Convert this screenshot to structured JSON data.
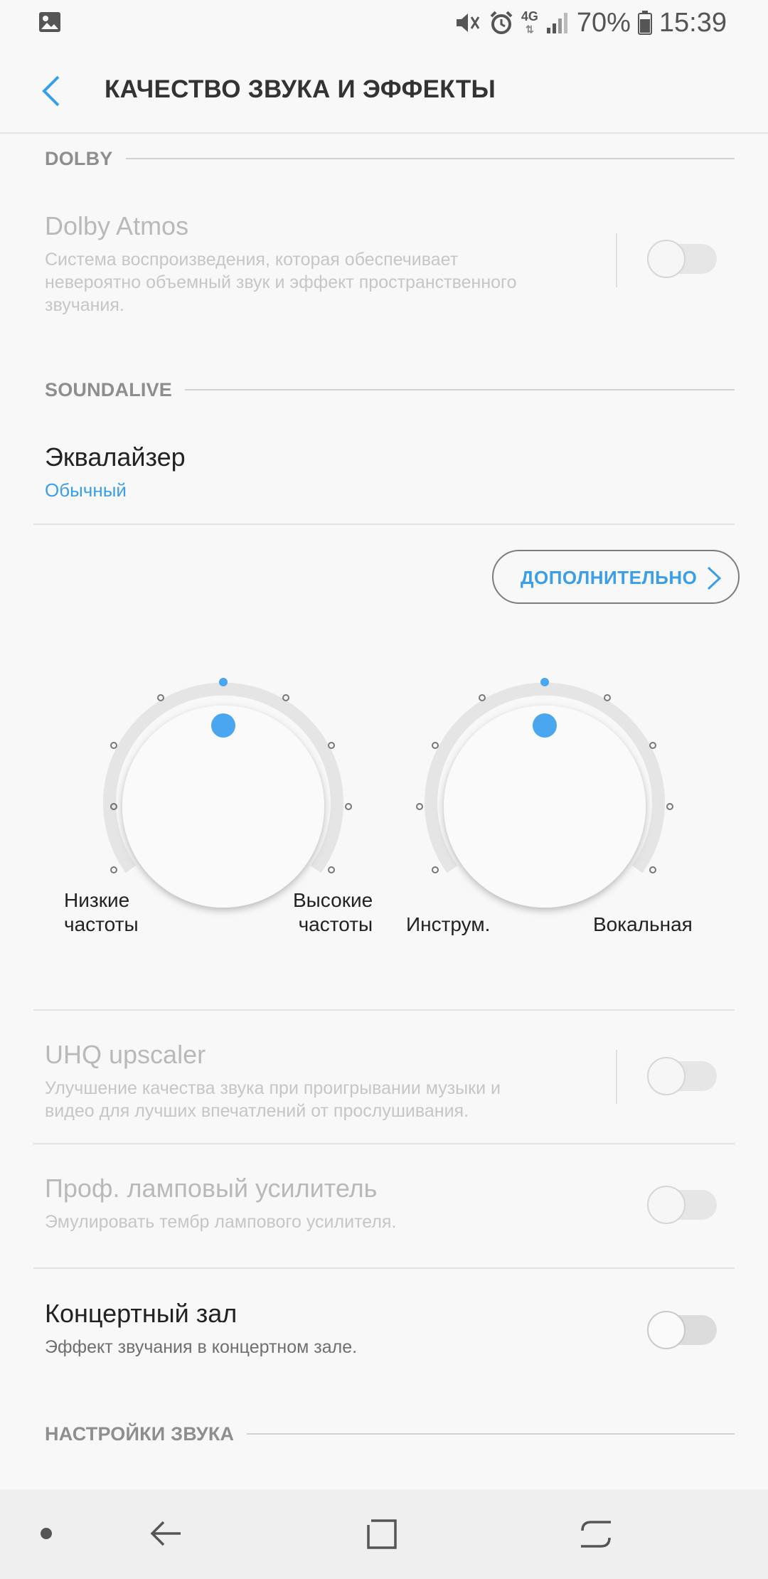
{
  "status_bar": {
    "battery_percent": "70%",
    "time": "15:39",
    "network": "4G",
    "icons": [
      "gallery-icon",
      "mute-icon",
      "alarm-icon",
      "network-4g-icon",
      "signal-icon",
      "battery-icon"
    ]
  },
  "app_bar": {
    "title": "КАЧЕСТВО ЗВУКА И ЭФФЕКТЫ",
    "back_icon": "chevron-left-icon"
  },
  "sections": {
    "dolby": "DOLBY",
    "soundalive": "SOUNDALIVE",
    "sound_settings": "НАСТРОЙКИ ЗВУКА"
  },
  "dolby_atmos": {
    "title": "Dolby Atmos",
    "summary_lines": [
      "Система воспроизведения, которая обеспечивает",
      "невероятно объемный звук и эффект пространственного",
      "звучания."
    ],
    "enabled": false,
    "available": false
  },
  "equalizer": {
    "title": "Эквалайзер",
    "value": "Обычный"
  },
  "more_button": {
    "label": "ДОПОЛНИТЕЛЬНО"
  },
  "knobs": {
    "tone": {
      "left_label_lines": [
        "Низкие",
        "частоты"
      ],
      "right_label_lines": [
        "Высокие",
        "частоты"
      ],
      "level": 0.5
    },
    "instrument_vocal": {
      "left_label": "Инструм.",
      "right_label": "Вокальная",
      "level": 0.5
    }
  },
  "uhq_upscaler": {
    "title": "UHQ upscaler",
    "summary_lines": [
      "Улучшение качества звука при проигрывании музыки и",
      "видео для лучших впечатлений от прослушивания."
    ],
    "enabled": false,
    "available": false
  },
  "tube_amp": {
    "title": "Проф. ламповый усилитель",
    "summary": "Эмулировать тембр лампового усилителя.",
    "enabled": false,
    "available": false
  },
  "concert_hall": {
    "title": "Концертный зал",
    "summary": "Эффект звучания в концертном зале.",
    "enabled": false,
    "available": true
  },
  "colors": {
    "accent": "#3a9ee8",
    "background": "#f8f8f8",
    "nav_bar": "#efefef"
  },
  "nav_bar": {
    "icons": [
      "dot-icon",
      "back-arrow-icon",
      "home-square-icon",
      "recents-icon"
    ]
  }
}
